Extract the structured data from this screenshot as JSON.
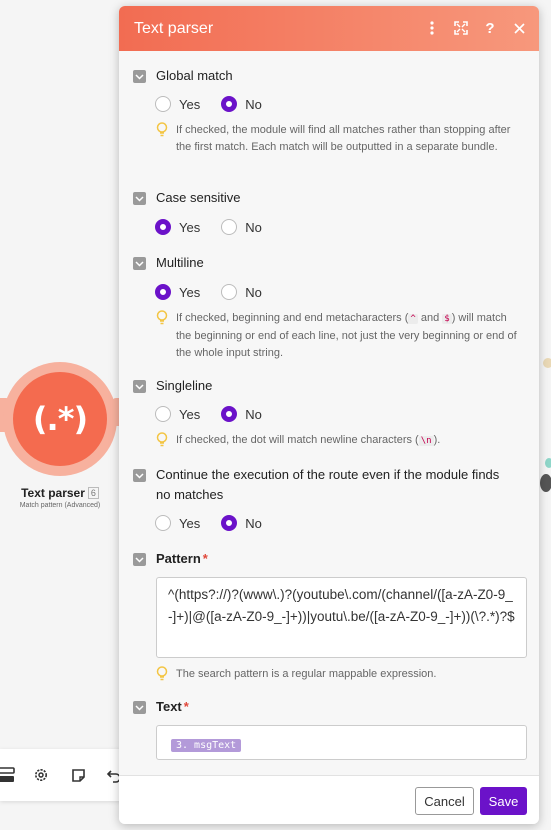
{
  "module": {
    "glyph": "(.*)",
    "title": "Text parser",
    "badge": "6",
    "subtitle": "Match pattern (Advanced)"
  },
  "panel": {
    "title": "Text parser",
    "header_icons": [
      "more-vertical-icon",
      "maximize-icon",
      "help-icon",
      "close-icon"
    ]
  },
  "options": {
    "yes": "Yes",
    "no": "No"
  },
  "sections": {
    "global_match": {
      "label": "Global match",
      "selected": "No",
      "hint": "If checked, the module will find all matches rather than stopping after the first match. Each match will be outputted in a separate bundle."
    },
    "case_sensitive": {
      "label": "Case sensitive",
      "selected": "Yes"
    },
    "multiline": {
      "label": "Multiline",
      "selected": "Yes",
      "hint_before": "If checked, beginning and end metacharacters (",
      "code1": "^",
      "hint_and": " and ",
      "code2": "$",
      "hint_after": ") will match the beginning or end of each line, not just the very beginning or end of the whole input string."
    },
    "singleline": {
      "label": "Singleline",
      "selected": "No",
      "hint_before": "If checked, the dot will match newline characters (",
      "code": "\\n",
      "hint_after": ")."
    },
    "continue_execution": {
      "label": "Continue the execution of the route even if the module finds no matches",
      "selected": "No"
    },
    "pattern": {
      "label": "Pattern",
      "required": "*",
      "value": "^(https?://)?(www\\.)?(youtube\\.com/(channel/([a-zA-Z0-9_-]+)|@([a-zA-Z0-9_-]+))|youtu\\.be/([a-zA-Z0-9_-]+))(\\?.*)?$",
      "hint": "The search pattern is a regular mappable expression."
    },
    "text": {
      "label": "Text",
      "required": "*",
      "pill": "3. msgText"
    }
  },
  "footer": {
    "cancel": "Cancel",
    "save": "Save"
  },
  "colors": {
    "accent": "#6b12c9",
    "header_start": "#f26c52",
    "header_end": "#f7987c",
    "module": "#f46b4f",
    "pill": "#b39ad9"
  }
}
